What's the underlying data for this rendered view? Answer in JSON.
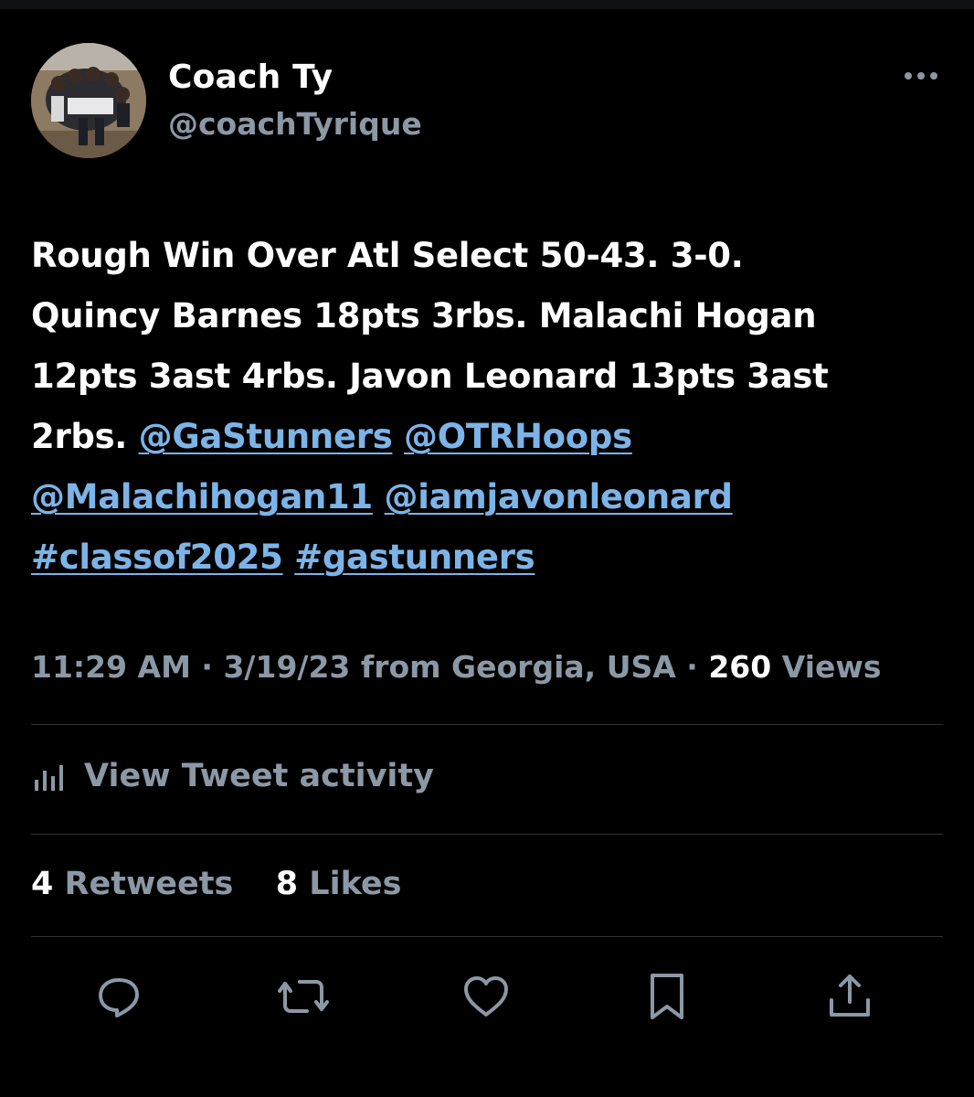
{
  "author": {
    "display_name": "Coach Ty",
    "handle": "@coachTyrique"
  },
  "tweet": {
    "text_lines_plain": [
      "Rough Win Over Atl Select 50-43. 3-0.",
      "Quincy Barnes 18pts 3rbs. Malachi Hogan",
      "12pts 3ast 4rbs. Javon Leonard 13pts 3ast",
      "2rbs."
    ],
    "mentions": [
      "@GaStunners",
      "@OTRHoops",
      "@Malachihogan11",
      "@iamjavonleonard"
    ],
    "hashtags": [
      "#classof2025",
      "#gastunners"
    ]
  },
  "meta": {
    "time": "11:29 AM",
    "separator": "·",
    "date_location": "3/19/23 from Georgia, USA",
    "views_count": "260",
    "views_label": "Views"
  },
  "activity": {
    "label": "View Tweet activity",
    "icon": "bar-chart-icon"
  },
  "stats": {
    "retweets_count": "4",
    "retweets_label": "Retweets",
    "likes_count": "8",
    "likes_label": "Likes"
  },
  "actions": [
    {
      "name": "reply",
      "icon": "reply-icon"
    },
    {
      "name": "retweet",
      "icon": "retweet-icon"
    },
    {
      "name": "like",
      "icon": "heart-icon"
    },
    {
      "name": "bookmark",
      "icon": "bookmark-icon"
    },
    {
      "name": "share",
      "icon": "share-icon"
    }
  ],
  "colors": {
    "background": "#000000",
    "text": "#ffffff",
    "secondary": "#8b98a5",
    "link": "#7cb4e8",
    "divider": "#2f3336"
  }
}
